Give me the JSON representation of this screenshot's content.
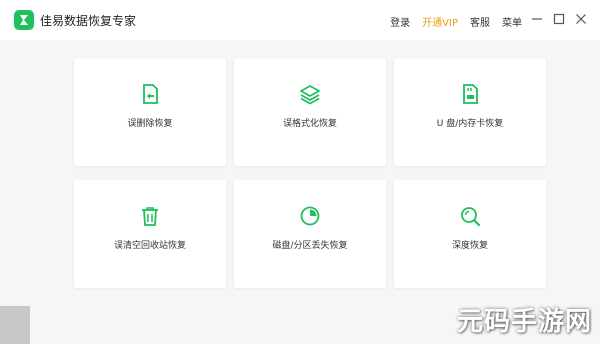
{
  "app": {
    "title": "佳易数据恢复专家",
    "logo_icon": "app-logo-icon",
    "accent": "#1fbf5a"
  },
  "top_links": {
    "login": "登录",
    "vip": "开通VIP",
    "support": "客服",
    "menu": "菜单"
  },
  "window_controls": [
    "minimize-icon",
    "maximize-icon",
    "close-icon"
  ],
  "cards": [
    {
      "label": "误删除恢复",
      "icon": "file-restore-icon"
    },
    {
      "label": "误格式化恢复",
      "icon": "layers-icon"
    },
    {
      "label": "U 盘/内存卡恢复",
      "icon": "sd-card-icon"
    },
    {
      "label": "误清空回收站恢复",
      "icon": "trash-icon"
    },
    {
      "label": "磁盘/分区丢失恢复",
      "icon": "partition-pie-icon"
    },
    {
      "label": "深度恢复",
      "icon": "deep-search-icon"
    }
  ],
  "watermark": "元码手游网"
}
